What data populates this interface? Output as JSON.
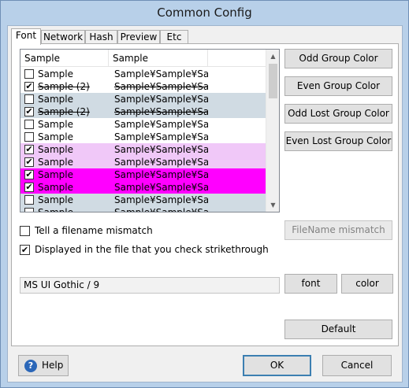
{
  "window": {
    "title": "Common Config"
  },
  "tabs": [
    {
      "label": "Font",
      "active": true
    },
    {
      "label": "Network",
      "active": false
    },
    {
      "label": "Hash",
      "active": false
    },
    {
      "label": "Preview",
      "active": false
    },
    {
      "label": "Etc",
      "active": false
    }
  ],
  "list": {
    "columns": [
      "Sample",
      "Sample"
    ],
    "rows": [
      {
        "checked": false,
        "col1": "Sample",
        "col2": "Sample¥Sample¥Sa...",
        "bg": "#ffffff",
        "strike": false
      },
      {
        "checked": true,
        "col1": "Sample (2)",
        "col2": "Sample¥Sample¥Sa...",
        "bg": "#ffffff",
        "strike": true
      },
      {
        "checked": false,
        "col1": "Sample",
        "col2": "Sample¥Sample¥Sa...",
        "bg": "#d0dbe3",
        "strike": false
      },
      {
        "checked": true,
        "col1": "Sample (2)",
        "col2": "Sample¥Sample¥Sa...",
        "bg": "#d0dbe3",
        "strike": true
      },
      {
        "checked": false,
        "col1": "Sample",
        "col2": "Sample¥Sample¥Sa...",
        "bg": "#ffffff",
        "strike": false
      },
      {
        "checked": false,
        "col1": "Sample",
        "col2": "Sample¥Sample¥Sa...",
        "bg": "#ffffff",
        "strike": false
      },
      {
        "checked": true,
        "col1": "Sample",
        "col2": "Sample¥Sample¥Sa...",
        "bg": "#f0c8f8",
        "strike": false
      },
      {
        "checked": true,
        "col1": "Sample",
        "col2": "Sample¥Sample¥Sa...",
        "bg": "#f0c8f8",
        "strike": false
      },
      {
        "checked": true,
        "col1": "Sample",
        "col2": "Sample¥Sample¥Sa...",
        "bg": "#ff00ff",
        "strike": false
      },
      {
        "checked": true,
        "col1": "Sample",
        "col2": "Sample¥Sample¥Sa...",
        "bg": "#ff00ff",
        "strike": false
      },
      {
        "checked": false,
        "col1": "Sample",
        "col2": "Sample¥Sample¥Sa...",
        "bg": "#d0dbe3",
        "strike": false
      },
      {
        "checked": false,
        "col1": "Sample",
        "col2": "Sample¥Sample¥Sa...",
        "bg": "#d0dbe3",
        "strike": false
      }
    ]
  },
  "color_buttons": {
    "odd_group": "Odd Group Color",
    "even_group": "Even Group Color",
    "odd_lost_group": "Odd Lost Group Color",
    "even_lost_group": "Even Lost Group Color"
  },
  "options": {
    "tell_mismatch": {
      "label": "Tell a filename mismatch",
      "checked": false
    },
    "strikethrough": {
      "label": "Displayed in the file that you check strikethrough",
      "checked": true
    }
  },
  "filename_mismatch_button": "FileName mismatch",
  "font": {
    "value": "MS UI Gothic / 9",
    "font_button": "font",
    "color_button": "color"
  },
  "default_button": "Default",
  "footer": {
    "help": "Help",
    "ok": "OK",
    "cancel": "Cancel"
  }
}
